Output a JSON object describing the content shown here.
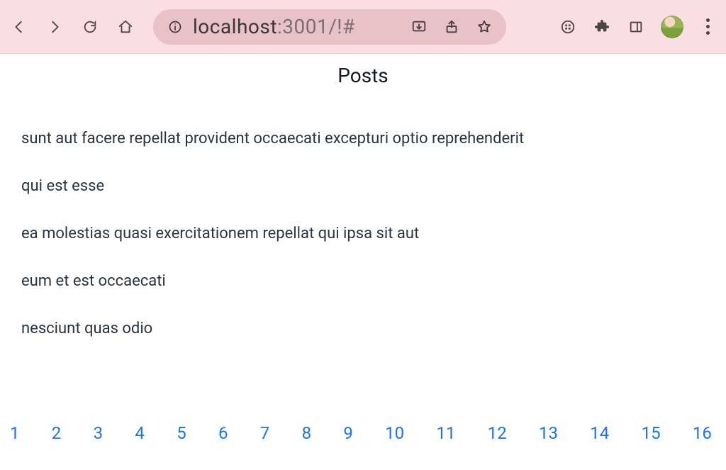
{
  "browser": {
    "url_host": "localhost",
    "url_port_path": ":3001/!#"
  },
  "page": {
    "title": "Posts",
    "posts": [
      "sunt aut facere repellat provident occaecati excepturi optio reprehenderit",
      "qui est esse",
      "ea molestias quasi exercitationem repellat qui ipsa sit aut",
      "eum et est occaecati",
      "nesciunt quas odio"
    ],
    "pages": [
      "1",
      "2",
      "3",
      "4",
      "5",
      "6",
      "7",
      "8",
      "9",
      "10",
      "11",
      "12",
      "13",
      "14",
      "15",
      "16"
    ]
  }
}
